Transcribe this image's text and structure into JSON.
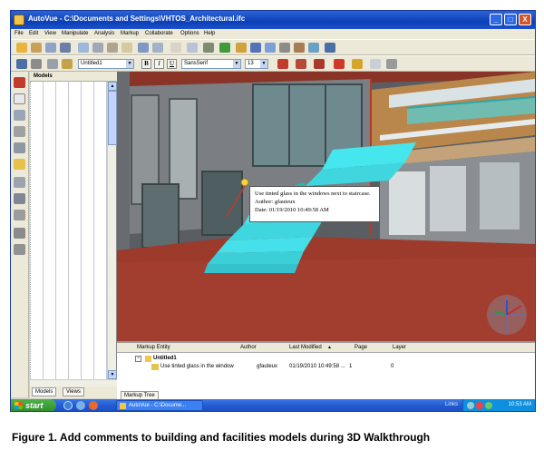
{
  "window": {
    "title": "AutoVue - C:\\Documents and Settings\\VHTOS_Architectural.ifc",
    "controls": [
      "_",
      "□",
      "X"
    ]
  },
  "menu": [
    "File",
    "Edit",
    "View",
    "Manipulate",
    "Analysis",
    "Markup",
    "Collaborate",
    "Options",
    "Help"
  ],
  "toolbar2": {
    "layer_name": "Untitled1",
    "font_name": "SansSerif",
    "font_size": "13",
    "bold": "B",
    "italic": "I",
    "underline": "U"
  },
  "models_panel": {
    "title": "Models",
    "tabs": [
      "Models",
      "Views"
    ]
  },
  "annotation": {
    "lines": [
      "Use tinted glass in the windows next to staircase.",
      "Author: gfauteux",
      "Date: 01/19/2010 10:49:58 AM"
    ]
  },
  "markup_pane": {
    "columns": [
      "Markup Entity",
      "Author",
      "Last Modified",
      "Page",
      "Layer"
    ],
    "sort_indicator": "▲",
    "group_row": "Untitled1",
    "rows": [
      {
        "entity": "Use tinted glass in the window",
        "author": "gfauteux",
        "modified": "01/19/2010 10:49:58 ...",
        "page": "1",
        "layer": "0"
      }
    ],
    "tab": "Markup Tree"
  },
  "taskbar": {
    "start": "start",
    "task": "AutoVue - C:\\Docume...",
    "links": "Links",
    "clock": "10:53 AM"
  },
  "caption": "Figure 1.  Add comments to building and facilities models during 3D Walkthrough",
  "colors": {
    "title_bar": "#0a3fb7",
    "chrome": "#ece9d8",
    "floor": "#9c3a2c",
    "stairs": "#3fe2ea",
    "taskbar": "#245ad0",
    "start": "#3a9a35"
  },
  "icons": [
    "app-icon",
    "minimize-icon",
    "maximize-icon",
    "close-icon",
    "open-icon",
    "print-icon",
    "zoom-icon",
    "rotate-icon",
    "pan-icon",
    "select-icon",
    "save-icon",
    "pen-icon",
    "color-icon",
    "note-icon",
    "windows-flag-icon",
    "navigation-cube-icon"
  ]
}
